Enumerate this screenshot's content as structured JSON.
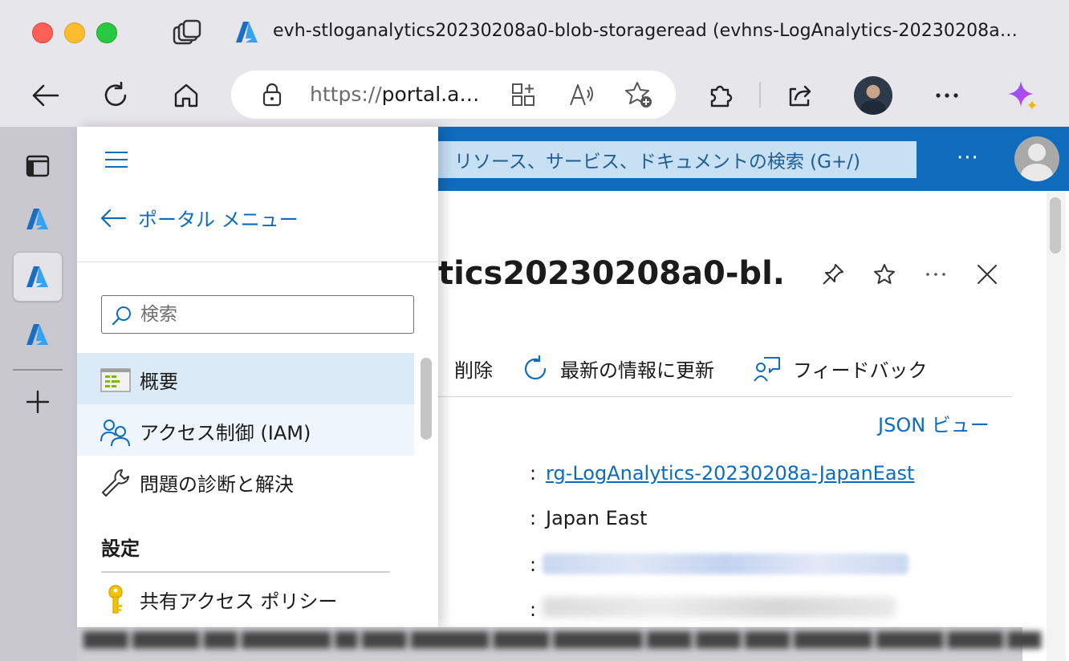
{
  "browser": {
    "tab_title": "evh-stloganalytics20230208a0-blob-storageread (evhns-LogAnalytics-20230208a…",
    "address": {
      "scheme": "https://",
      "host": "portal.a…"
    },
    "colors": {
      "chrome_bg": "#e7e6ea",
      "accent": "#0f6cbd"
    }
  },
  "azure": {
    "search_placeholder": "リソース、サービス、ドキュメントの検索 (G+/)",
    "more_label": "···",
    "blade": {
      "title": "tics20230208a0-bl...",
      "commands": [
        {
          "icon": "trash-icon",
          "label": "削除"
        },
        {
          "icon": "refresh-icon",
          "label": "最新の情報に更新"
        },
        {
          "icon": "feedback-icon",
          "label": "フィードバック"
        }
      ],
      "json_view_label": "JSON ビュー",
      "properties": {
        "colon": ":",
        "resource_group": "rg-LogAnalytics-20230208a-JapanEast",
        "location": "Japan East"
      }
    }
  },
  "menu": {
    "back_label": "ポータル メニュー",
    "search_placeholder": "検索",
    "items": [
      {
        "icon": "overview-icon",
        "label": "概要",
        "state": "selected"
      },
      {
        "icon": "people-icon",
        "label": "アクセス制御 (IAM)",
        "state": "hover"
      },
      {
        "icon": "wrench-icon",
        "label": "問題の診断と解決",
        "state": "normal"
      }
    ],
    "group_heading": "設定",
    "group_items": [
      {
        "icon": "key-icon",
        "label": "共有アクセス ポリシー"
      }
    ]
  },
  "status_bar": {
    "text": "████ ██████ ███ ████████ ██ ████ ███████ █████ ████████ ████ ████ ████ ███████ ██████ █████ ███"
  }
}
